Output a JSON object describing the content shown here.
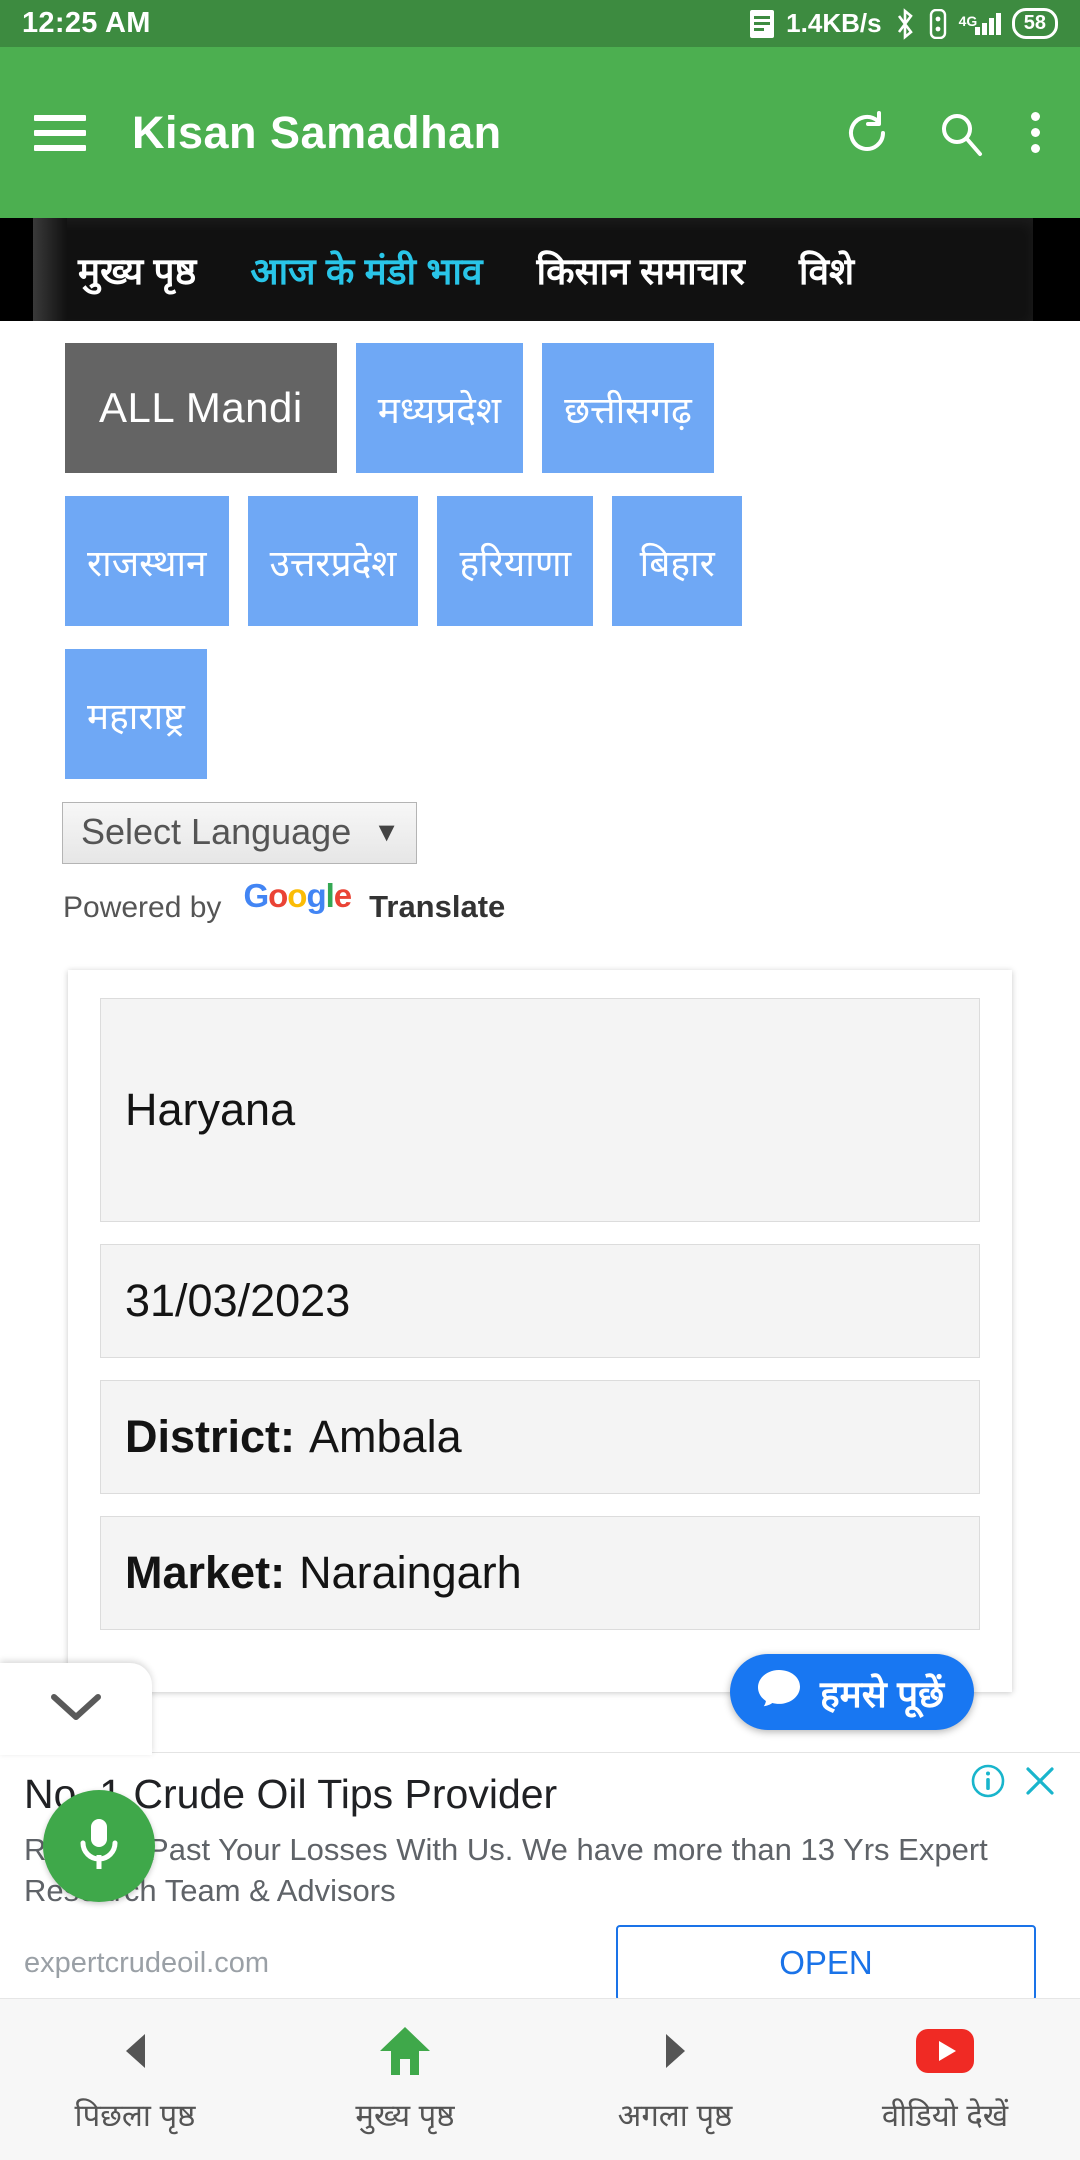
{
  "status_bar": {
    "time": "12:25 AM",
    "net_speed": "1.4KB/s",
    "network_type": "4G",
    "battery": "58",
    "icons": [
      "document-icon",
      "bluetooth-icon",
      "sim-icon",
      "signal-icon",
      "battery-icon"
    ]
  },
  "app_bar": {
    "title": "Kisan Samadhan",
    "menu_icon": "hamburger-icon",
    "refresh_icon": "refresh-icon",
    "search_icon": "search-icon",
    "overflow_icon": "kebab-menu-icon",
    "background": "#4caf50"
  },
  "tabs": [
    {
      "label": "मुख्य पृष्ठ",
      "active": false
    },
    {
      "label": "आज के मंडी भाव",
      "active": true
    },
    {
      "label": "किसान समाचार",
      "active": false
    },
    {
      "label": "विशे",
      "active": false
    }
  ],
  "tab_active_color": "#29c5e8",
  "state_buttons": {
    "row1": [
      "ALL Mandi",
      "मध्यप्रदेश",
      "छत्तीसगढ़"
    ],
    "row2": [
      "राजस्थान",
      "उत्तरप्रदेश",
      "हरियाणा",
      "बिहार"
    ],
    "row3": [
      "महाराष्ट्र"
    ],
    "selected": "ALL Mandi",
    "selected_color": "#646464",
    "default_color": "#6fa8f5"
  },
  "language_widget": {
    "select_label": "Select Language",
    "caret": "▼",
    "powered_by": "Powered by",
    "google_letters": [
      "G",
      "o",
      "o",
      "g",
      "l",
      "e"
    ],
    "translate": "Translate"
  },
  "mandi_card": {
    "state": "Haryana",
    "date": "31/03/2023",
    "district_label": "District:",
    "district_value": "Ambala",
    "market_label": "Market:",
    "market_value": "Naraingarh"
  },
  "chat_fab": {
    "label": "हमसे पूछें",
    "icon": "chat-bubble-icon",
    "color": "#1877f2"
  },
  "collapse_tab": {
    "icon": "chevron-down-icon"
  },
  "mic_fab": {
    "icon": "microphone-icon",
    "color": "#3fa84a"
  },
  "ad": {
    "title": "No. 1 Crude Oil Tips Provider",
    "body": "Recover Past Your Losses With Us. We have more than 13 Yrs Expert Research Team & Advisors",
    "url": "expertcrudeoil.com",
    "cta": "OPEN",
    "info_icon": "info-icon",
    "close_icon": "close-icon",
    "accent": "#1a73e8",
    "icon_color": "#19b5cc"
  },
  "bottom_nav": [
    {
      "label": "पिछला पृष्ठ",
      "icon": "arrow-left-icon"
    },
    {
      "label": "मुख्य पृष्ठ",
      "icon": "home-icon"
    },
    {
      "label": "अगला पृष्ठ",
      "icon": "arrow-right-icon"
    },
    {
      "label": "वीडियो देखें",
      "icon": "youtube-icon"
    }
  ]
}
